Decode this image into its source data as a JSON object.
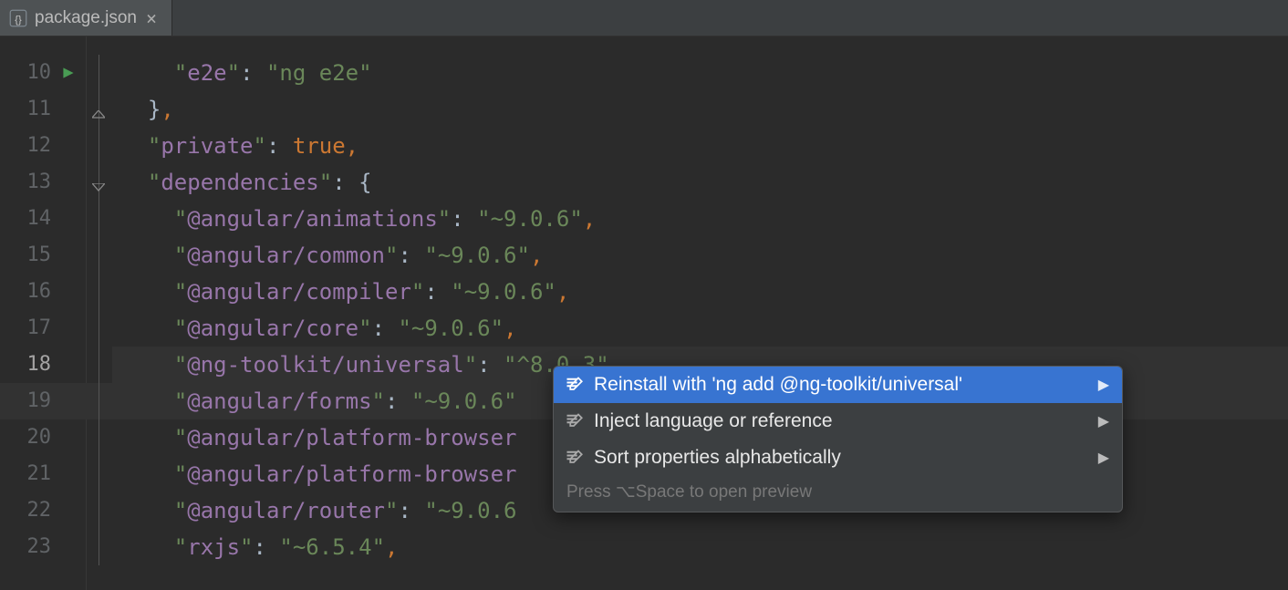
{
  "tab": {
    "filename": "package.json"
  },
  "editor": {
    "current_line_number": 18,
    "lines": [
      {
        "num": 10,
        "run_marker": true,
        "tokens": [
          {
            "t": "    ",
            "c": ""
          },
          {
            "t": "\"",
            "c": "q"
          },
          {
            "t": "e2e",
            "c": "key"
          },
          {
            "t": "\"",
            "c": "q"
          },
          {
            "t": ": ",
            "c": "br"
          },
          {
            "t": "\"",
            "c": "q"
          },
          {
            "t": "ng e2e",
            "c": "str"
          },
          {
            "t": "\"",
            "c": "q"
          }
        ]
      },
      {
        "num": 11,
        "fold": "end",
        "tokens": [
          {
            "t": "  ",
            "c": ""
          },
          {
            "t": "}",
            "c": "br"
          },
          {
            "t": ",",
            "c": "punct"
          }
        ]
      },
      {
        "num": 12,
        "tokens": [
          {
            "t": "  ",
            "c": ""
          },
          {
            "t": "\"",
            "c": "q"
          },
          {
            "t": "private",
            "c": "key"
          },
          {
            "t": "\"",
            "c": "q"
          },
          {
            "t": ": ",
            "c": "br"
          },
          {
            "t": "true",
            "c": "kw"
          },
          {
            "t": ",",
            "c": "punct"
          }
        ]
      },
      {
        "num": 13,
        "fold": "start",
        "tokens": [
          {
            "t": "  ",
            "c": ""
          },
          {
            "t": "\"",
            "c": "q"
          },
          {
            "t": "dependencies",
            "c": "key"
          },
          {
            "t": "\"",
            "c": "q"
          },
          {
            "t": ": ",
            "c": "br"
          },
          {
            "t": "{",
            "c": "br"
          }
        ]
      },
      {
        "num": 14,
        "tokens": [
          {
            "t": "    ",
            "c": ""
          },
          {
            "t": "\"",
            "c": "q"
          },
          {
            "t": "@angular/animations",
            "c": "key"
          },
          {
            "t": "\"",
            "c": "q"
          },
          {
            "t": ": ",
            "c": "br"
          },
          {
            "t": "\"",
            "c": "q"
          },
          {
            "t": "~9.0.6",
            "c": "str"
          },
          {
            "t": "\"",
            "c": "q"
          },
          {
            "t": ",",
            "c": "punct"
          }
        ]
      },
      {
        "num": 15,
        "tokens": [
          {
            "t": "    ",
            "c": ""
          },
          {
            "t": "\"",
            "c": "q"
          },
          {
            "t": "@angular/common",
            "c": "key"
          },
          {
            "t": "\"",
            "c": "q"
          },
          {
            "t": ": ",
            "c": "br"
          },
          {
            "t": "\"",
            "c": "q"
          },
          {
            "t": "~9.0.6",
            "c": "str"
          },
          {
            "t": "\"",
            "c": "q"
          },
          {
            "t": ",",
            "c": "punct"
          }
        ]
      },
      {
        "num": 16,
        "tokens": [
          {
            "t": "    ",
            "c": ""
          },
          {
            "t": "\"",
            "c": "q"
          },
          {
            "t": "@angular/compiler",
            "c": "key"
          },
          {
            "t": "\"",
            "c": "q"
          },
          {
            "t": ": ",
            "c": "br"
          },
          {
            "t": "\"",
            "c": "q"
          },
          {
            "t": "~9.0.6",
            "c": "str"
          },
          {
            "t": "\"",
            "c": "q"
          },
          {
            "t": ",",
            "c": "punct"
          }
        ]
      },
      {
        "num": 17,
        "tokens": [
          {
            "t": "    ",
            "c": ""
          },
          {
            "t": "\"",
            "c": "q"
          },
          {
            "t": "@angular/core",
            "c": "key"
          },
          {
            "t": "\"",
            "c": "q"
          },
          {
            "t": ": ",
            "c": "br"
          },
          {
            "t": "\"",
            "c": "q"
          },
          {
            "t": "~9.0.6",
            "c": "str"
          },
          {
            "t": "\"",
            "c": "q"
          },
          {
            "t": ",",
            "c": "punct"
          }
        ]
      },
      {
        "num": 18,
        "highlight": true,
        "tokens": [
          {
            "t": "    ",
            "c": ""
          },
          {
            "t": "\"",
            "c": "q"
          },
          {
            "t": "@ng-toolkit/universal",
            "c": "key"
          },
          {
            "t": "\"",
            "c": "q"
          },
          {
            "t": ": ",
            "c": "br"
          },
          {
            "t": "\"",
            "c": "q"
          },
          {
            "t": "^8.0.3",
            "c": "str"
          },
          {
            "t": "\"",
            "c": "q"
          },
          {
            "t": ",",
            "c": "punct"
          }
        ]
      },
      {
        "num": 19,
        "tokens": [
          {
            "t": "    ",
            "c": ""
          },
          {
            "t": "\"",
            "c": "q"
          },
          {
            "t": "@angular/forms",
            "c": "key"
          },
          {
            "t": "\"",
            "c": "q"
          },
          {
            "t": ": ",
            "c": "br"
          },
          {
            "t": "\"",
            "c": "q"
          },
          {
            "t": "~9.0.6",
            "c": "str"
          },
          {
            "t": "\"",
            "c": "q"
          }
        ]
      },
      {
        "num": 20,
        "tokens": [
          {
            "t": "    ",
            "c": ""
          },
          {
            "t": "\"",
            "c": "q"
          },
          {
            "t": "@angular/platform-browser",
            "c": "key"
          }
        ]
      },
      {
        "num": 21,
        "tokens": [
          {
            "t": "    ",
            "c": ""
          },
          {
            "t": "\"",
            "c": "q"
          },
          {
            "t": "@angular/platform-browser",
            "c": "key"
          }
        ]
      },
      {
        "num": 22,
        "tokens": [
          {
            "t": "    ",
            "c": ""
          },
          {
            "t": "\"",
            "c": "q"
          },
          {
            "t": "@angular/router",
            "c": "key"
          },
          {
            "t": "\"",
            "c": "q"
          },
          {
            "t": ": ",
            "c": "br"
          },
          {
            "t": "\"",
            "c": "q"
          },
          {
            "t": "~9.0.6",
            "c": "str"
          }
        ]
      },
      {
        "num": 23,
        "tokens": [
          {
            "t": "    ",
            "c": ""
          },
          {
            "t": "\"",
            "c": "q"
          },
          {
            "t": "rxjs",
            "c": "key"
          },
          {
            "t": "\"",
            "c": "q"
          },
          {
            "t": ": ",
            "c": "br"
          },
          {
            "t": "\"",
            "c": "q"
          },
          {
            "t": "~6.5.4",
            "c": "str"
          },
          {
            "t": "\"",
            "c": "q"
          },
          {
            "t": ",",
            "c": "punct"
          }
        ]
      }
    ]
  },
  "popup": {
    "items": [
      {
        "label": "Reinstall with 'ng add @ng-toolkit/universal'",
        "selected": true,
        "submenu": true
      },
      {
        "label": "Inject language or reference",
        "selected": false,
        "submenu": true
      },
      {
        "label": "Sort properties alphabetically",
        "selected": false,
        "submenu": true
      }
    ],
    "hint": "Press ⌥Space to open preview"
  }
}
